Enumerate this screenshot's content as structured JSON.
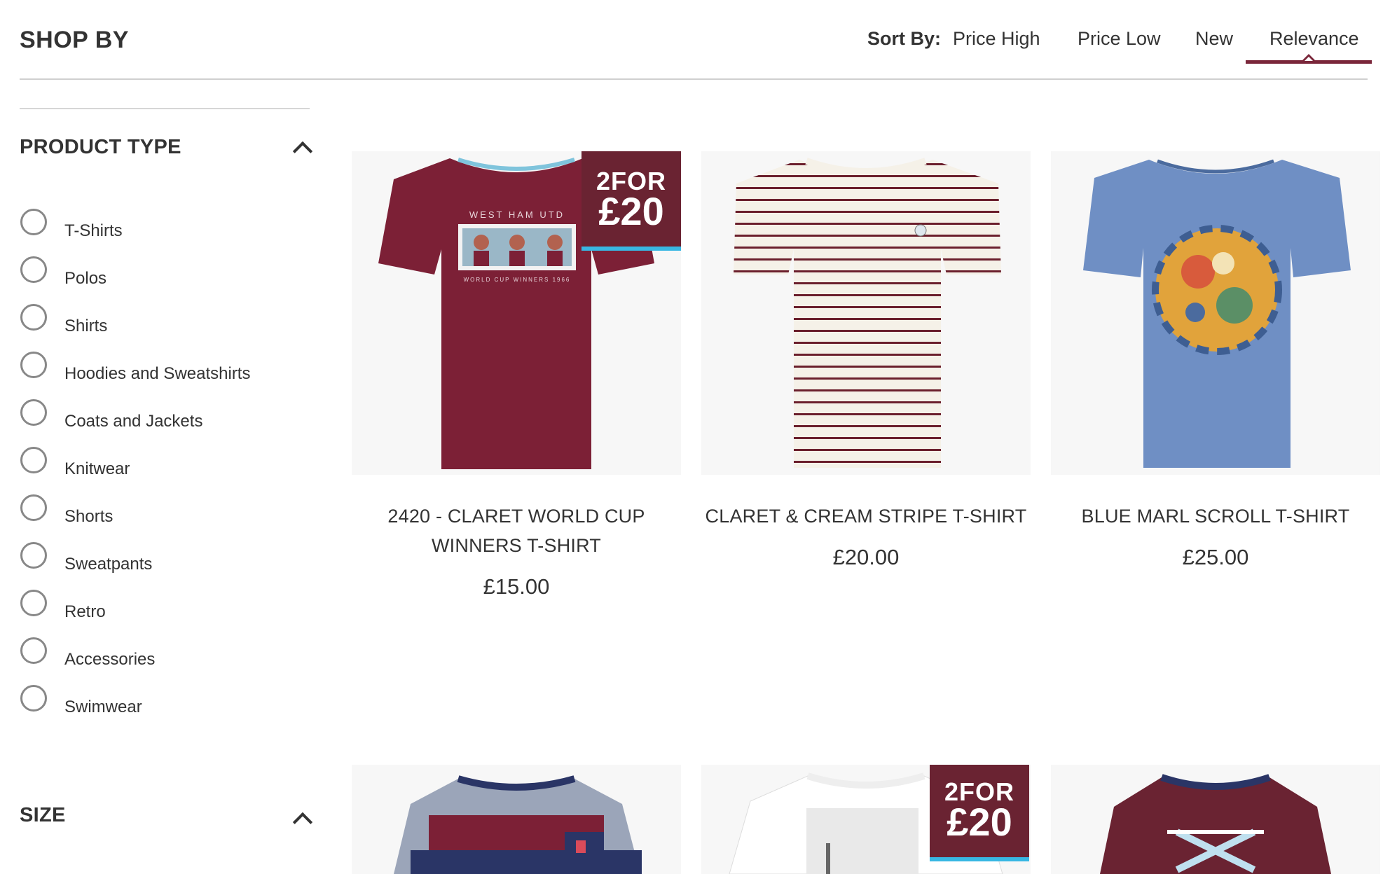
{
  "header": {
    "title": "SHOP BY",
    "sort_label": "Sort By:",
    "sort_options": [
      "Price High",
      "Price Low",
      "New",
      "Relevance"
    ],
    "active_sort": "Relevance"
  },
  "filters": {
    "product_type": {
      "title": "PRODUCT TYPE",
      "options": [
        "T-Shirts",
        "Polos",
        "Shirts",
        "Hoodies and Sweatshirts",
        "Coats and Jackets",
        "Knitwear",
        "Shorts",
        "Sweatpants",
        "Retro",
        "Accessories",
        "Swimwear"
      ]
    },
    "size": {
      "title": "SIZE"
    }
  },
  "products": [
    {
      "name_line1": "2420 - CLARET WORLD CUP",
      "name_line2": "WINNERS T-SHIRT",
      "price": "£15.00",
      "badge_line1": "2FOR",
      "badge_line2": "£20",
      "print_text_top": "WEST HAM UTD",
      "print_text_bottom": "WORLD CUP WINNERS 1966",
      "color": "#7c2036"
    },
    {
      "name": "CLARET & CREAM STRIPE T-SHIRT",
      "price": "£20.00",
      "color": "#f5f1e8"
    },
    {
      "name": "BLUE MARL SCROLL T-SHIRT",
      "price": "£25.00",
      "color": "#6f8fc4"
    },
    {
      "color": "#2a3566"
    },
    {
      "badge_line1": "2FOR",
      "badge_line2": "£20",
      "color": "#ffffff"
    },
    {
      "color": "#6a2332"
    }
  ],
  "colors": {
    "accent": "#7a263a",
    "badge_bg": "#6a2332",
    "badge_stripe": "#38b7e3"
  }
}
